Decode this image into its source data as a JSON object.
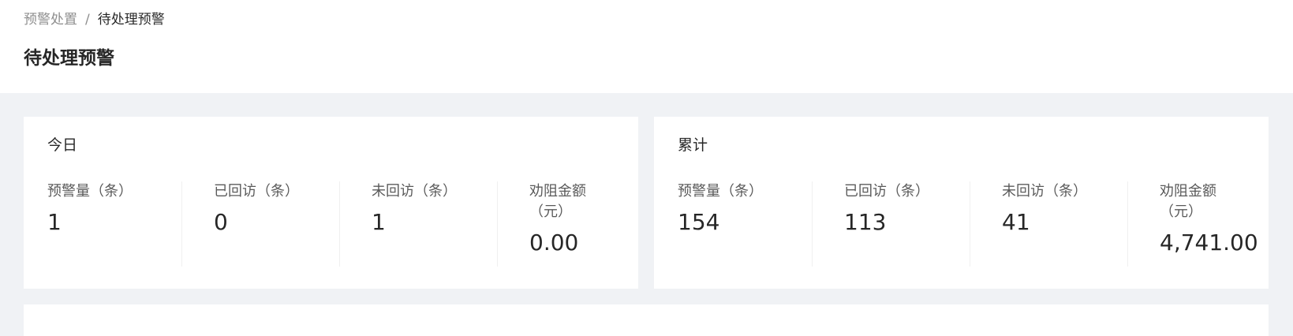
{
  "breadcrumb": {
    "parent": "预警处置",
    "separator": "/",
    "current": "待处理预警"
  },
  "page": {
    "title": "待处理预警"
  },
  "today": {
    "title": "今日",
    "stats": [
      {
        "label": "预警量（条）",
        "value": "1"
      },
      {
        "label": "已回访（条）",
        "value": "0"
      },
      {
        "label": "未回访（条）",
        "value": "1"
      },
      {
        "label": "劝阻金额（元）",
        "value": "0.00"
      }
    ]
  },
  "total": {
    "title": "累计",
    "stats": [
      {
        "label": "预警量（条）",
        "value": "154"
      },
      {
        "label": "已回访（条）",
        "value": "113"
      },
      {
        "label": "未回访（条）",
        "value": "41"
      },
      {
        "label": "劝阻金额（元）",
        "value": "4,741.00"
      }
    ]
  },
  "colors": {
    "background": "#f0f2f5",
    "card": "#ffffff",
    "divider": "#f0f0f0"
  }
}
